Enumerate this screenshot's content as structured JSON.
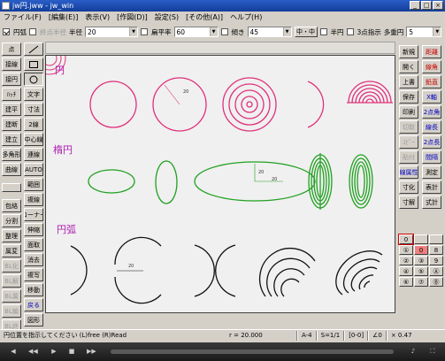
{
  "window": {
    "title": "jw円.jww - jw_win",
    "controls": [
      "_",
      "□",
      "×"
    ]
  },
  "menu": [
    "ファイル(F)",
    "[編集(E)]",
    "表示(V)",
    "[作図(D)]",
    "設定(S)",
    "[その他(A)]",
    "ヘルプ(H)"
  ],
  "toolbar": {
    "circle_label": "円弧",
    "circle_checked": true,
    "radius_end_label": "終点半径",
    "radius_label": "半径",
    "radius_value": "20",
    "flatness_label": "扁平率",
    "flatness_value": "60",
    "tilt_label": "傾き",
    "tilt_value": "45",
    "center_button": "中・中",
    "half_circle_label": "半円",
    "three_point_label": "3点指示",
    "multi_circle_label": "多重円",
    "multi_circle_value": "5"
  },
  "left_col1": [
    "点",
    "接線",
    "接円",
    "ﾊｯﾁ",
    "建平",
    "建断",
    "建立",
    "多角形",
    "曲線",
    "",
    "包絡",
    "分割",
    "整理",
    "属変",
    "BL化",
    "BL解",
    "BL属",
    "BL編",
    "BL終",
    "ﾃﾞｰﾀ"
  ],
  "left_col2": [
    "／",
    "□",
    "○",
    "文字",
    "寸法",
    "2線",
    "中心線",
    "連線",
    "AUTO",
    "範囲",
    "複線",
    "コーナー",
    "伸縮",
    "面取",
    "消去",
    "複写",
    "移動",
    "戻る",
    "図形",
    "図登"
  ],
  "right_col1": [
    "新規",
    "開く",
    "上書",
    "保存",
    "印刷",
    "切取",
    "ｺﾋﾟｰ",
    "貼付",
    "線属性",
    "寸化",
    "寸解",
    "",
    "",
    "",
    ""
  ],
  "right_col2": [
    "距離",
    "線角",
    "鉛直",
    "X軸",
    "2点角",
    "線長",
    "2点長",
    "間隔",
    "測定",
    "表計",
    "式計",
    "式計",
    "ｶﾞﾗｹﾞ"
  ],
  "right_extra": [
    "",
    "",
    "",
    "",
    "",
    "",
    "",
    "",
    "",
    "",
    "",
    "",
    ""
  ],
  "numpad": [
    "0",
    "0",
    "",
    "1",
    "0",
    "8",
    "2",
    "3",
    "4",
    "5",
    "6",
    "7",
    "8",
    "9",
    "0"
  ],
  "canvas": {
    "label_circle": "円",
    "label_ellipse": "楕円",
    "label_arc": "円弧",
    "dim_r": "20",
    "dim_a": "20",
    "dim_b": "20",
    "dim_e": "20",
    "dim_arc": "20"
  },
  "status": {
    "message": "円位置を指示してください (L)free (R)Read",
    "radius": "r = 20.000",
    "paper": "A-4",
    "scale": "S=1/1",
    "layer": "[0-0]",
    "angle": "∠0",
    "zoom": "× 0.47"
  },
  "colors": {
    "circle": "#e0307a",
    "ellipse": "#20a020",
    "arc": "#111111",
    "label": "#b020b0"
  }
}
